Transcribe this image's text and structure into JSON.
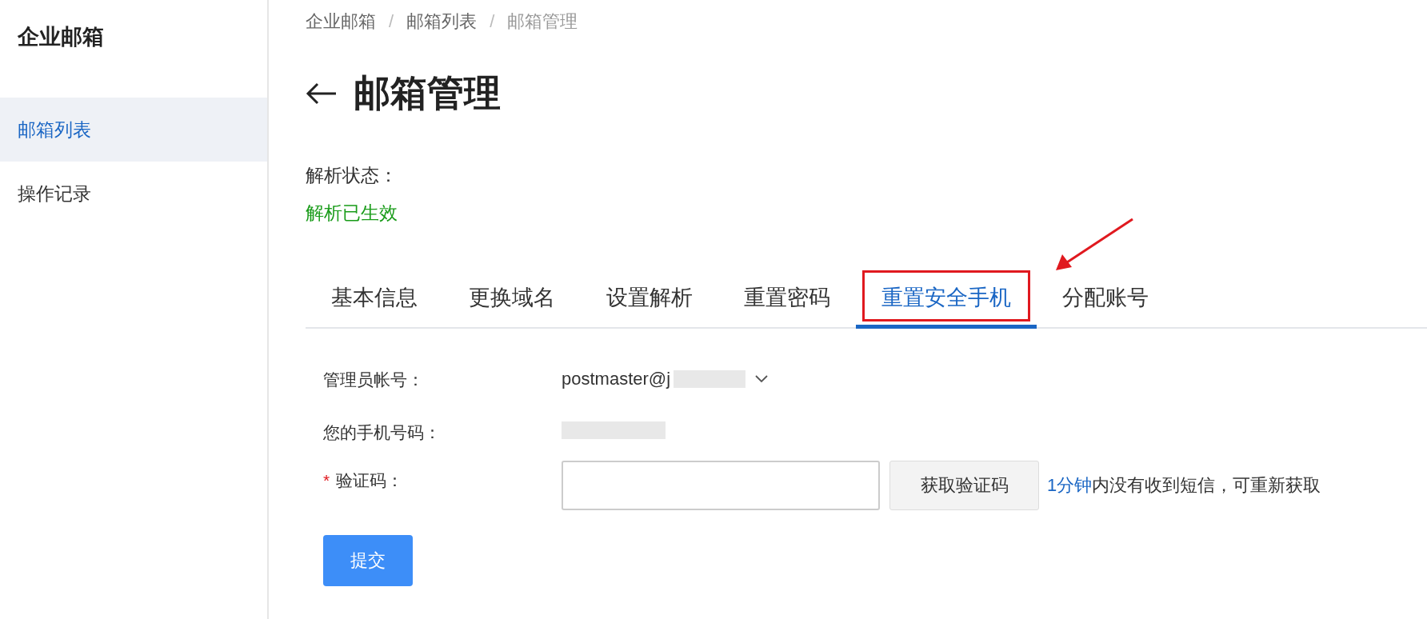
{
  "sidebar": {
    "title": "企业邮箱",
    "items": [
      {
        "label": "邮箱列表",
        "selected": true
      },
      {
        "label": "操作记录",
        "selected": false
      }
    ]
  },
  "breadcrumb": [
    {
      "kind": "link",
      "text": "企业邮箱"
    },
    {
      "kind": "separator",
      "text": "/"
    },
    {
      "kind": "link",
      "text": "邮箱列表"
    },
    {
      "kind": "separator",
      "text": "/"
    },
    {
      "kind": "current",
      "text": "邮箱管理"
    }
  ],
  "page_title": "邮箱管理",
  "status": {
    "label": "解析状态：",
    "value": "解析已生效"
  },
  "tabs": [
    {
      "label": "基本信息",
      "selected": false,
      "highlighted": false
    },
    {
      "label": "更换域名",
      "selected": false,
      "highlighted": false
    },
    {
      "label": "设置解析",
      "selected": false,
      "highlighted": false
    },
    {
      "label": "重置密码",
      "selected": false,
      "highlighted": false
    },
    {
      "label": "重置安全手机",
      "selected": true,
      "highlighted": true
    },
    {
      "label": "分配账号",
      "selected": false,
      "highlighted": false
    }
  ],
  "form": {
    "admin_account": {
      "label": "管理员帐号：",
      "value": "postmaster@j"
    },
    "phone": {
      "label": "您的手机号码："
    },
    "code": {
      "label": "验证码：",
      "required_mark": "*",
      "button": "获取验证码",
      "hint_link": "1分钟",
      "hint": "内没有收到短信，可重新获取"
    },
    "submit": "提交"
  }
}
